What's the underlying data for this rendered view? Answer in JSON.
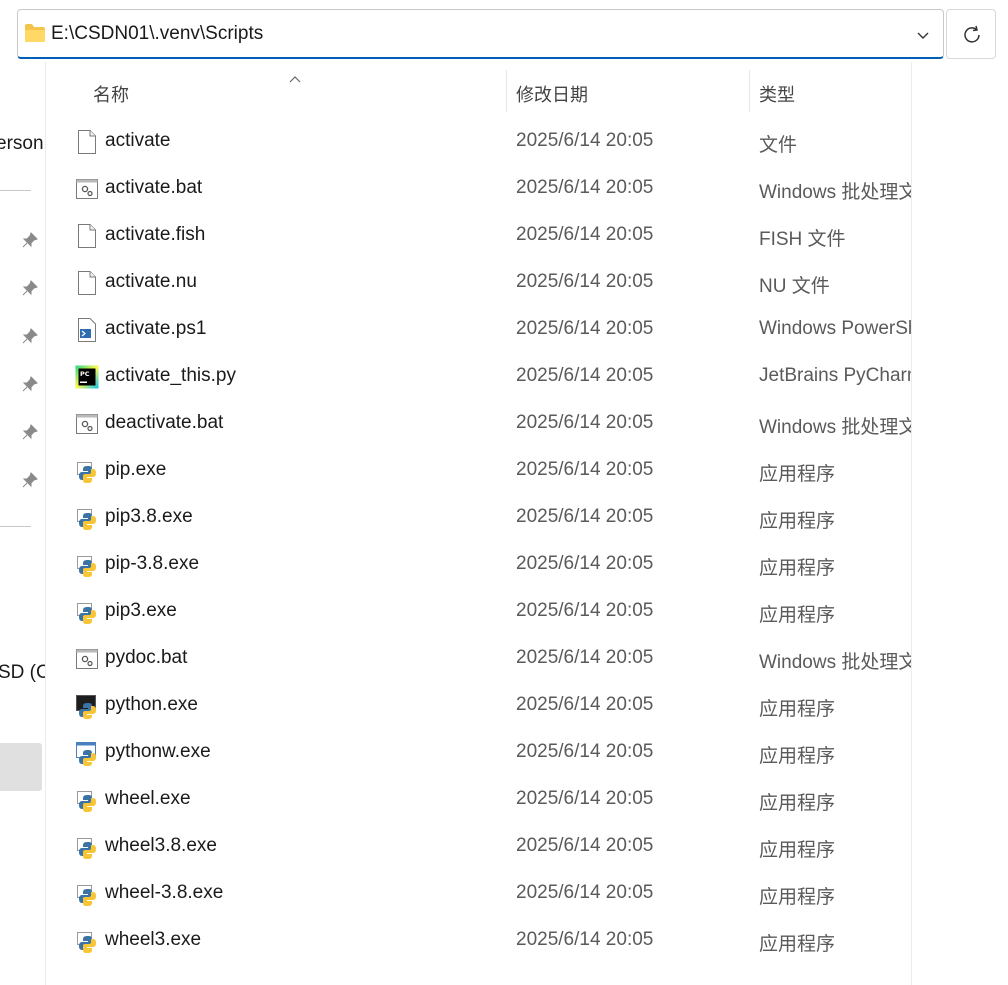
{
  "address_bar": {
    "path": "E:\\CSDN01\\.venv\\Scripts"
  },
  "nav": {
    "partial_labels": [
      "erson",
      "SD (C"
    ]
  },
  "columns": {
    "name": "名称",
    "date": "修改日期",
    "type": "类型"
  },
  "files": [
    {
      "name": "activate",
      "date": "2025/6/14 20:05",
      "type": "文件",
      "icon": "blank-file-icon"
    },
    {
      "name": "activate.bat",
      "date": "2025/6/14 20:05",
      "type": "Windows 批处理文件",
      "icon": "batch-file-icon"
    },
    {
      "name": "activate.fish",
      "date": "2025/6/14 20:05",
      "type": "FISH 文件",
      "icon": "blank-file-icon"
    },
    {
      "name": "activate.nu",
      "date": "2025/6/14 20:05",
      "type": "NU 文件",
      "icon": "blank-file-icon"
    },
    {
      "name": "activate.ps1",
      "date": "2025/6/14 20:05",
      "type": "Windows PowerShell",
      "icon": "powershell-script-icon"
    },
    {
      "name": "activate_this.py",
      "date": "2025/6/14 20:05",
      "type": "JetBrains PyCharm",
      "icon": "pycharm-icon"
    },
    {
      "name": "deactivate.bat",
      "date": "2025/6/14 20:05",
      "type": "Windows 批处理文件",
      "icon": "batch-file-icon"
    },
    {
      "name": "pip.exe",
      "date": "2025/6/14 20:05",
      "type": "应用程序",
      "icon": "python-exe-icon"
    },
    {
      "name": "pip3.8.exe",
      "date": "2025/6/14 20:05",
      "type": "应用程序",
      "icon": "python-exe-icon"
    },
    {
      "name": "pip-3.8.exe",
      "date": "2025/6/14 20:05",
      "type": "应用程序",
      "icon": "python-exe-icon"
    },
    {
      "name": "pip3.exe",
      "date": "2025/6/14 20:05",
      "type": "应用程序",
      "icon": "python-exe-icon"
    },
    {
      "name": "pydoc.bat",
      "date": "2025/6/14 20:05",
      "type": "Windows 批处理文件",
      "icon": "batch-file-icon"
    },
    {
      "name": "python.exe",
      "date": "2025/6/14 20:05",
      "type": "应用程序",
      "icon": "python-console-icon"
    },
    {
      "name": "pythonw.exe",
      "date": "2025/6/14 20:05",
      "type": "应用程序",
      "icon": "python-window-icon"
    },
    {
      "name": "wheel.exe",
      "date": "2025/6/14 20:05",
      "type": "应用程序",
      "icon": "python-exe-icon"
    },
    {
      "name": "wheel3.8.exe",
      "date": "2025/6/14 20:05",
      "type": "应用程序",
      "icon": "python-exe-icon"
    },
    {
      "name": "wheel-3.8.exe",
      "date": "2025/6/14 20:05",
      "type": "应用程序",
      "icon": "python-exe-icon"
    },
    {
      "name": "wheel3.exe",
      "date": "2025/6/14 20:05",
      "type": "应用程序",
      "icon": "python-exe-icon"
    }
  ]
}
